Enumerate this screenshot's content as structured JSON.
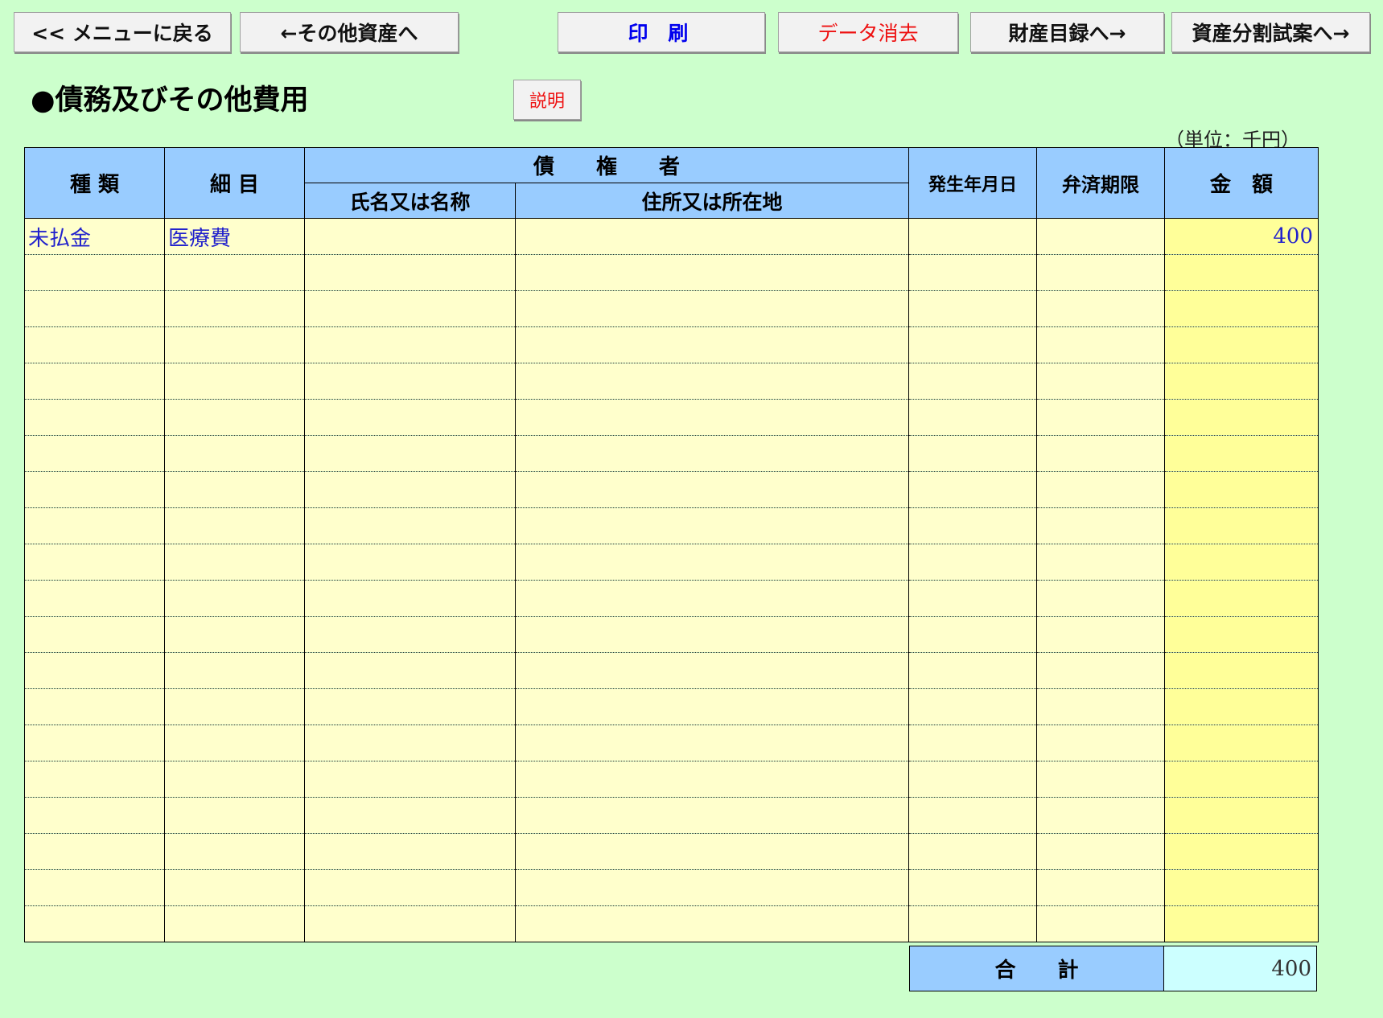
{
  "toolbar": {
    "back_menu": "<< メニューに戻る",
    "prev_other_assets": "←その他資産へ",
    "print": "印 刷",
    "clear_data": "データ消去",
    "property_list": "財産目録へ→",
    "asset_division": "資産分割試案へ→"
  },
  "page": {
    "title": "●債務及びその他費用",
    "explain": "説明",
    "unit": "（単位：千円）"
  },
  "table": {
    "headers": {
      "type": "種 類",
      "item": "細 目",
      "creditor": "債　　権　　者",
      "creditor_name": "氏名又は名称",
      "creditor_address": "住所又は所在地",
      "date": "発生年月日",
      "due": "弁済期限",
      "amount": "金　額"
    },
    "rows": [
      {
        "type": "未払金",
        "item": "医療費",
        "name": "",
        "address": "",
        "date": "",
        "due": "",
        "amount": "400"
      },
      {
        "type": "",
        "item": "",
        "name": "",
        "address": "",
        "date": "",
        "due": "",
        "amount": ""
      },
      {
        "type": "",
        "item": "",
        "name": "",
        "address": "",
        "date": "",
        "due": "",
        "amount": ""
      },
      {
        "type": "",
        "item": "",
        "name": "",
        "address": "",
        "date": "",
        "due": "",
        "amount": ""
      },
      {
        "type": "",
        "item": "",
        "name": "",
        "address": "",
        "date": "",
        "due": "",
        "amount": ""
      },
      {
        "type": "",
        "item": "",
        "name": "",
        "address": "",
        "date": "",
        "due": "",
        "amount": ""
      },
      {
        "type": "",
        "item": "",
        "name": "",
        "address": "",
        "date": "",
        "due": "",
        "amount": ""
      },
      {
        "type": "",
        "item": "",
        "name": "",
        "address": "",
        "date": "",
        "due": "",
        "amount": ""
      },
      {
        "type": "",
        "item": "",
        "name": "",
        "address": "",
        "date": "",
        "due": "",
        "amount": ""
      },
      {
        "type": "",
        "item": "",
        "name": "",
        "address": "",
        "date": "",
        "due": "",
        "amount": ""
      },
      {
        "type": "",
        "item": "",
        "name": "",
        "address": "",
        "date": "",
        "due": "",
        "amount": ""
      },
      {
        "type": "",
        "item": "",
        "name": "",
        "address": "",
        "date": "",
        "due": "",
        "amount": ""
      },
      {
        "type": "",
        "item": "",
        "name": "",
        "address": "",
        "date": "",
        "due": "",
        "amount": ""
      },
      {
        "type": "",
        "item": "",
        "name": "",
        "address": "",
        "date": "",
        "due": "",
        "amount": ""
      },
      {
        "type": "",
        "item": "",
        "name": "",
        "address": "",
        "date": "",
        "due": "",
        "amount": ""
      },
      {
        "type": "",
        "item": "",
        "name": "",
        "address": "",
        "date": "",
        "due": "",
        "amount": ""
      },
      {
        "type": "",
        "item": "",
        "name": "",
        "address": "",
        "date": "",
        "due": "",
        "amount": ""
      },
      {
        "type": "",
        "item": "",
        "name": "",
        "address": "",
        "date": "",
        "due": "",
        "amount": ""
      },
      {
        "type": "",
        "item": "",
        "name": "",
        "address": "",
        "date": "",
        "due": "",
        "amount": ""
      },
      {
        "type": "",
        "item": "",
        "name": "",
        "address": "",
        "date": "",
        "due": "",
        "amount": ""
      }
    ],
    "total_label": "合　　計",
    "total_value": "400"
  },
  "colors": {
    "background": "#ccffcc",
    "header": "#99ccff",
    "cell": "#ffffcc",
    "amount_cell": "#ffff99",
    "total_cell": "#ccffff",
    "input_text": "#2222cc"
  }
}
